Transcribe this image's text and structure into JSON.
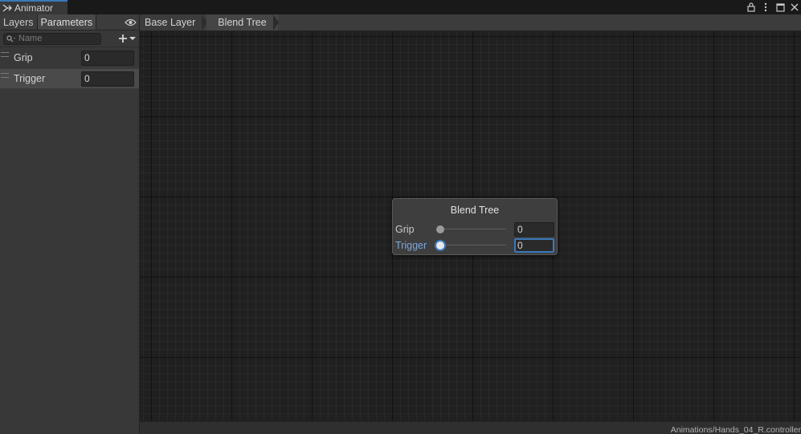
{
  "window": {
    "title": "Animator",
    "controls": [
      "lock-icon",
      "kebab-menu-icon",
      "maximize-icon",
      "close-icon"
    ]
  },
  "left_panel": {
    "tabs": [
      {
        "label": "Layers",
        "active": false
      },
      {
        "label": "Parameters",
        "active": true
      }
    ],
    "search": {
      "placeholder": "Name",
      "value": ""
    },
    "parameters": [
      {
        "name": "Grip",
        "value": "0"
      },
      {
        "name": "Trigger",
        "value": "0"
      }
    ]
  },
  "breadcrumb": {
    "items": [
      "Base Layer",
      "Blend Tree"
    ]
  },
  "node": {
    "title": "Blend Tree",
    "rows": [
      {
        "label": "Grip",
        "value": "0",
        "slider_fraction": 0
      },
      {
        "label": "Trigger",
        "value": "0",
        "slider_fraction": 0
      }
    ]
  },
  "status": {
    "path": "Animations/Hands_04_R.controller"
  },
  "colors": {
    "accent": "#3a79bb",
    "highlight_label": "#7fa6dc",
    "graph_background": "#202020"
  }
}
